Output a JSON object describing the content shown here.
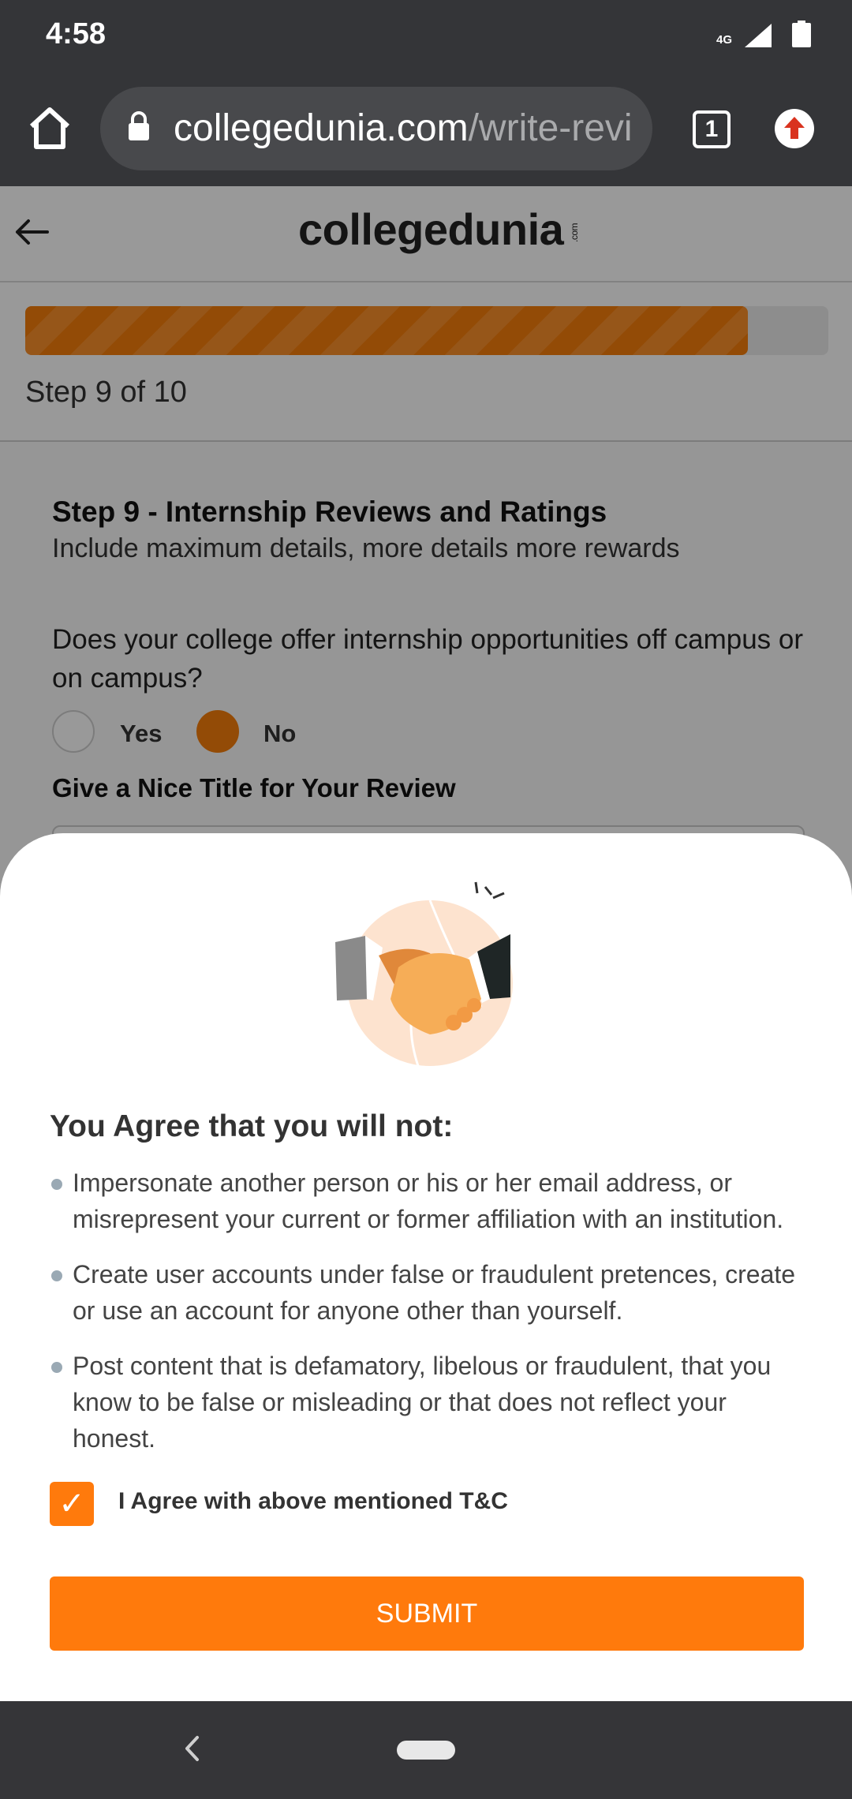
{
  "status_bar": {
    "time": "4:58",
    "network": "4G"
  },
  "browser": {
    "url_domain": "collegedunia.com",
    "url_path": "/write-revi",
    "tab_count": "1"
  },
  "site": {
    "logo": "collegedunia",
    "logo_suffix": ".com"
  },
  "progress": {
    "step_label": "Step 9 of 10",
    "fraction": 0.9
  },
  "form": {
    "step_title": "Step 9 - Internship Reviews and Ratings",
    "step_subtitle": "Include maximum details, more details more rewards",
    "question": "Does your college offer internship opportunities off campus or on campus?",
    "options": [
      {
        "label": "Yes",
        "selected": false
      },
      {
        "label": "No",
        "selected": true
      }
    ],
    "title_label": "Give a Nice Title for Your Review"
  },
  "modal": {
    "illustration": "handshake-icon",
    "heading": "You Agree that you will not:",
    "terms": [
      "Impersonate another person or his or her email address, or misrepresent your current or former affiliation with an institution.",
      "Create user accounts under false or fraudulent pretences, create or use an account for anyone other than yourself.",
      "Post content that is defamatory, libelous or fraudulent, that you know to be false or misleading or that does not reflect your honest."
    ],
    "checkbox_label": "I Agree with above mentioned T&C",
    "checkbox_checked": true,
    "submit_label": "SUBMIT"
  },
  "colors": {
    "accent": "#ff7a0c",
    "dark_bar": "#343538"
  }
}
